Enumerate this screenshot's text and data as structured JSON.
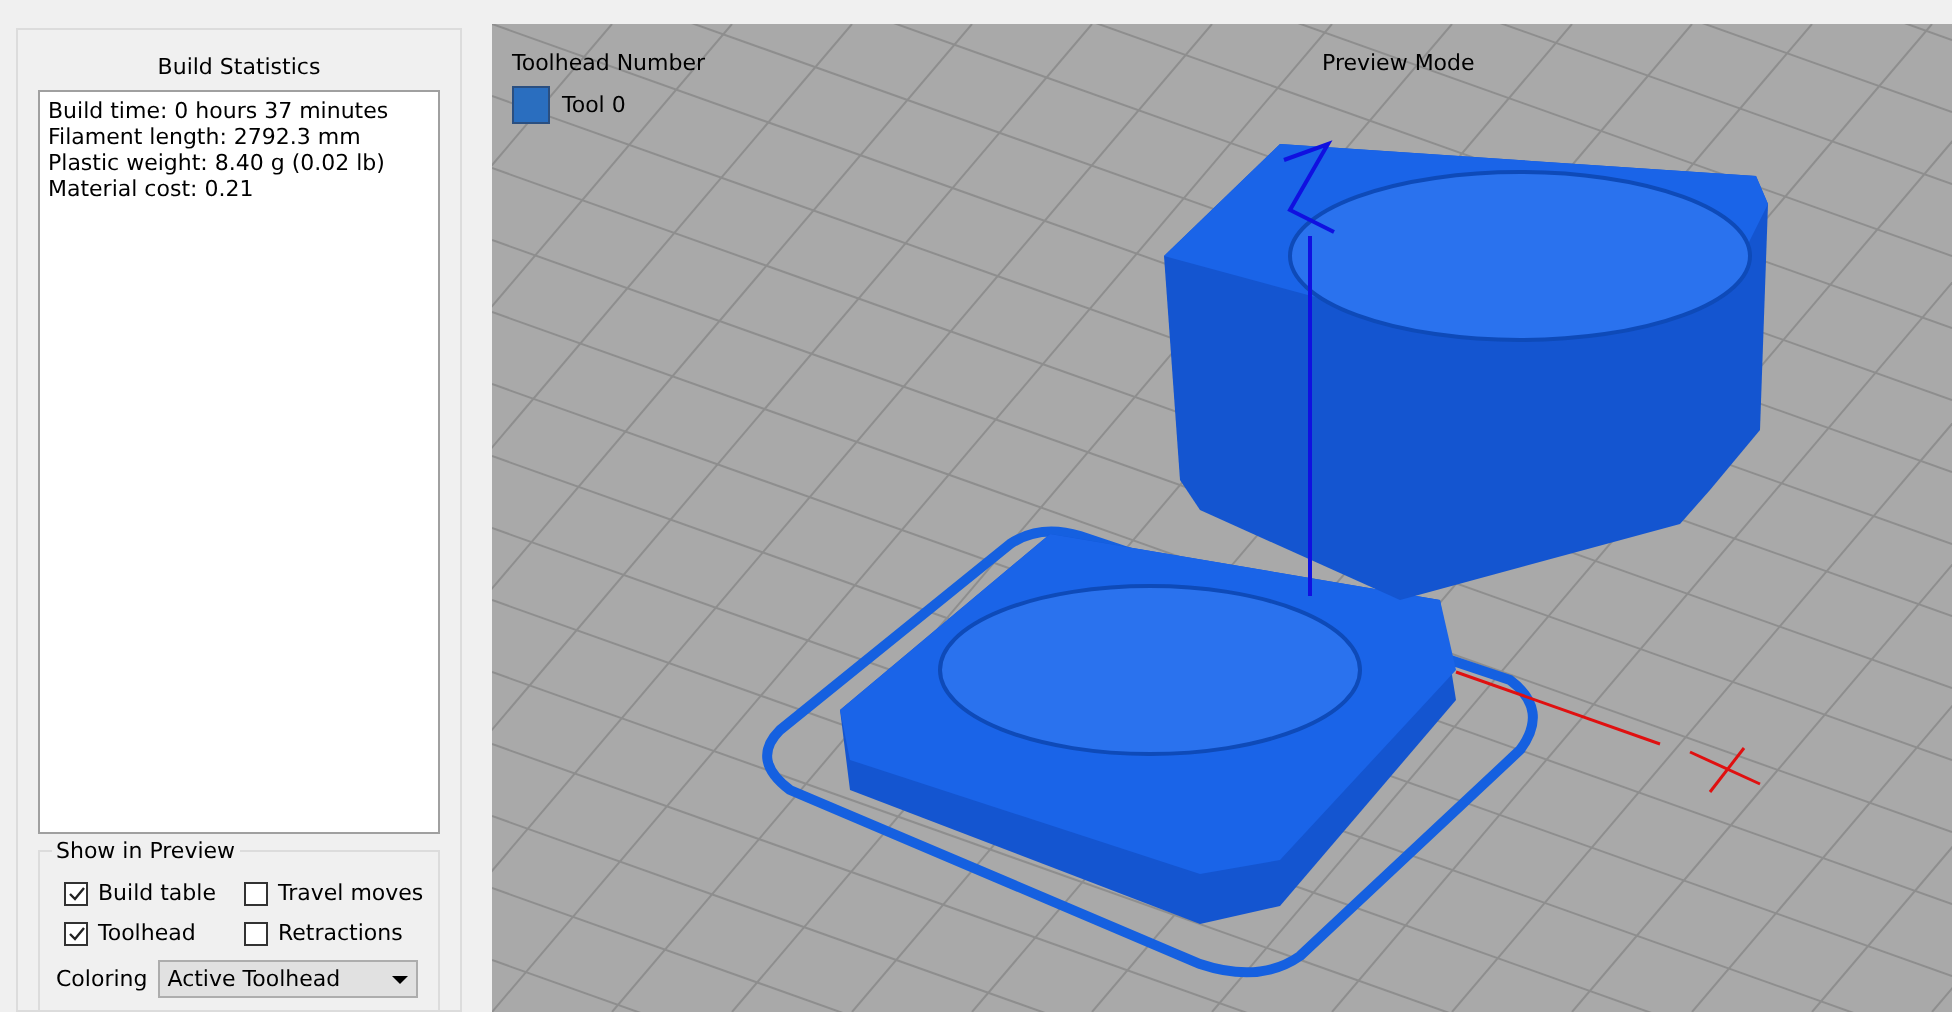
{
  "build_statistics": {
    "title": "Build Statistics",
    "lines": [
      "Build time: 0 hours 37 minutes",
      "Filament length: 2792.3 mm",
      "Plastic weight: 8.40 g (0.02 lb)",
      "Material cost: 0.21"
    ]
  },
  "show_in_preview": {
    "title": "Show in Preview",
    "options": [
      {
        "label": "Build table",
        "checked": true
      },
      {
        "label": "Travel moves",
        "checked": false
      },
      {
        "label": "Toolhead",
        "checked": true
      },
      {
        "label": "Retractions",
        "checked": false
      }
    ],
    "coloring": {
      "label": "Coloring",
      "value": "Active Toolhead"
    }
  },
  "viewport": {
    "legend_title": "Toolhead Number",
    "tools": [
      {
        "label": "Tool 0",
        "color": "#2a6ebf"
      }
    ],
    "mode_label": "Preview Mode"
  }
}
